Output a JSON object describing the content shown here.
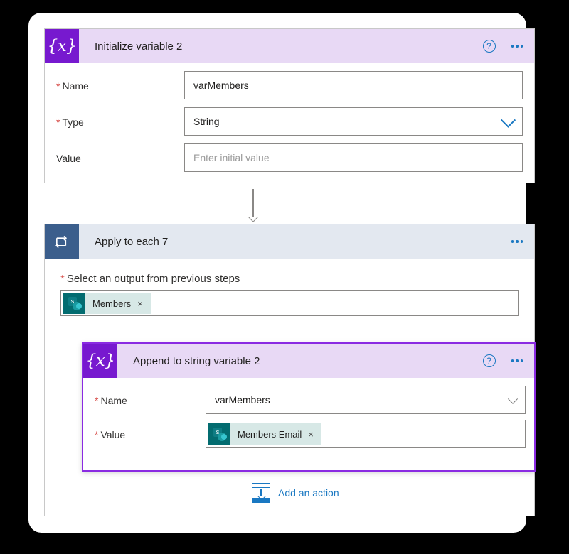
{
  "app": {
    "surface_color": "#ffffff",
    "background_color": "#000000"
  },
  "cards": {
    "initialize_variable": {
      "title": "Initialize variable 2",
      "icon": "variables-braces-icon",
      "icon_glyph": "{x}",
      "accent_color": "#7719cf",
      "header_color": "#e8d9f5",
      "help_label": "?",
      "fields": [
        {
          "label": "Name",
          "required": true,
          "value": "varMembers",
          "placeholder": "",
          "control": "text"
        },
        {
          "label": "Type",
          "required": true,
          "value": "String",
          "placeholder": "",
          "control": "dropdown"
        },
        {
          "label": "Value",
          "required": false,
          "value": "",
          "placeholder": "Enter initial value",
          "control": "text"
        }
      ]
    },
    "apply_to_each": {
      "title": "Apply to each 7",
      "icon": "loop-repeat-icon",
      "accent_color": "#3b5e8c",
      "header_color": "#e3e8f0",
      "output_label": "Select an output from previous steps",
      "output_required": true,
      "output_token": {
        "label": "Members",
        "icon": "sharepoint-icon",
        "icon_letter": "s",
        "remove_label": "×"
      },
      "add_action_label": "Add an action",
      "add_action_icon": "add-action-insert-icon"
    },
    "append_to_string": {
      "title": "Append to string variable 2",
      "icon": "variables-braces-icon",
      "icon_glyph": "{x}",
      "accent_color": "#7719cf",
      "header_color": "#e8d9f5",
      "selection_border_color": "#8a2be2",
      "help_label": "?",
      "name_field": {
        "label": "Name",
        "required": true,
        "value": "varMembers",
        "control": "dropdown"
      },
      "value_field": {
        "label": "Value",
        "required": true,
        "token": {
          "label": "Members Email",
          "icon": "sharepoint-icon",
          "icon_letter": "s",
          "remove_label": "×"
        }
      }
    }
  }
}
